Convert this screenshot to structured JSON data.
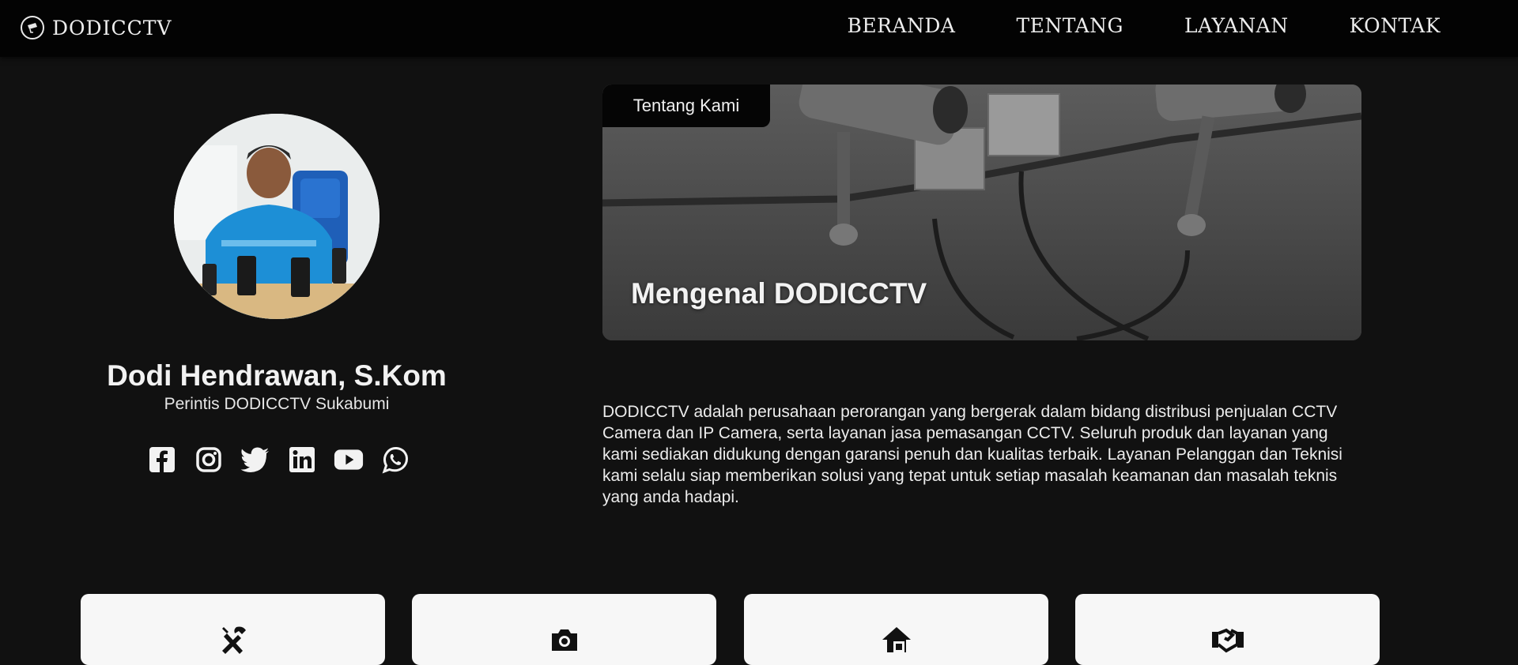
{
  "brand": {
    "name": "DODICCTV",
    "logo_icon": "cctv-logo-icon"
  },
  "nav": {
    "items": [
      {
        "label": "BERANDA"
      },
      {
        "label": "TENTANG"
      },
      {
        "label": "LAYANAN"
      },
      {
        "label": "KONTAK"
      }
    ]
  },
  "profile": {
    "name": "Dodi Hendrawan, S.Kom",
    "role": "Perintis DODICCTV Sukabumi",
    "socials": [
      "facebook-icon",
      "instagram-icon",
      "twitter-icon",
      "linkedin-icon",
      "youtube-icon",
      "whatsapp-icon"
    ]
  },
  "banner": {
    "tag": "Tentang Kami",
    "title": "Mengenal DODICCTV"
  },
  "about": {
    "text": "DODICCTV adalah perusahaan perorangan yang bergerak dalam bidang distribusi penjualan CCTV Camera dan IP Camera, serta layanan jasa pemasangan CCTV. Seluruh produk dan layanan yang kami sediakan didukung dengan garansi penuh dan kualitas terbaik. Layanan Pelanggan dan Teknisi kami selalu siap memberikan solusi yang tepat untuk setiap masalah keamanan dan masalah teknis yang anda hadapi."
  },
  "services": {
    "cards": [
      "tools-icon",
      "camera-icon",
      "home-security-icon",
      "handshake-icon"
    ]
  },
  "colors": {
    "background": "#111111",
    "navbar": "#030303",
    "text": "#ededed",
    "card": "#f7f7f7"
  }
}
